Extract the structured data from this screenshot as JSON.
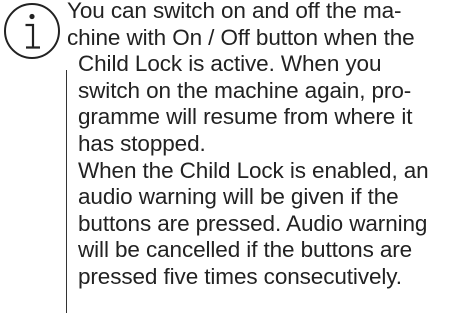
{
  "note": {
    "icon": "info-icon",
    "lines": [
      "You can switch on and off the ma-",
      "chine with On / Off button when the",
      "Child Lock is active. When you",
      "switch on the machine again, pro-",
      "gramme will resume from where it",
      "has stopped.",
      "When the Child Lock is enabled, an",
      "audio warning will be given if the",
      "buttons are pressed. Audio warning",
      "will be cancelled if the buttons are",
      "pressed five times consecutively."
    ]
  }
}
